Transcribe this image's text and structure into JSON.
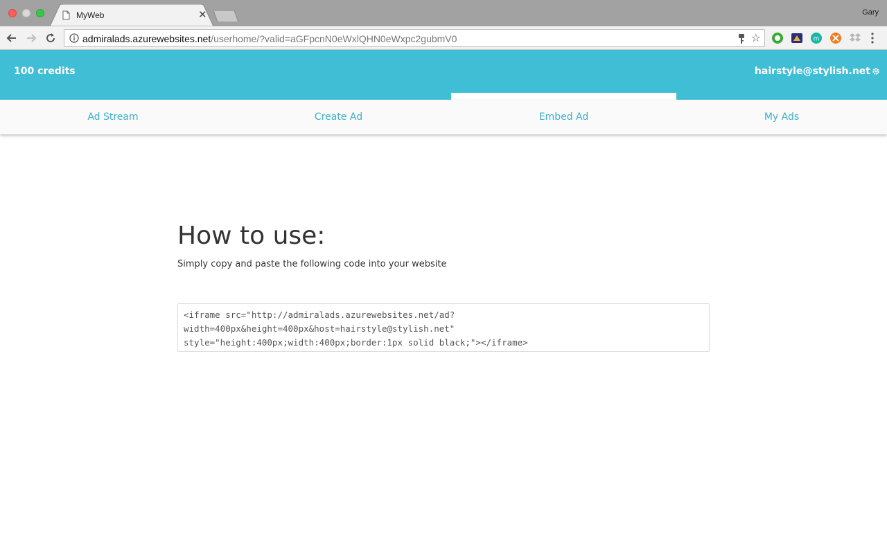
{
  "browser": {
    "tab_title": "MyWeb",
    "tab_close": "✕",
    "profile_name": "Gary",
    "url_host": "admiralads.azurewebsites.net",
    "url_path": "/userhome/?valid=aGFpcnN0eWxlQHN0eWxpc2gubmV0",
    "star": "☆"
  },
  "header": {
    "credits": "100 credits",
    "user_email": "hairstyle@stylish.net",
    "color": "#3fbed6"
  },
  "nav": {
    "tabs": [
      {
        "label": "Ad Stream"
      },
      {
        "label": "Create Ad"
      },
      {
        "label": "Embed Ad",
        "active": true
      },
      {
        "label": "My Ads"
      }
    ]
  },
  "main": {
    "heading": "How to use:",
    "subtext": "Simply copy and paste the following code into your website",
    "code_lines": [
      "<iframe src=\"http://admiralads.azurewebsites.net/ad?",
      "width=400px&height=400px&host=hairstyle@stylish.net\"",
      "style=\"height:400px;width:400px;border:1px solid black;\"></iframe>"
    ]
  }
}
